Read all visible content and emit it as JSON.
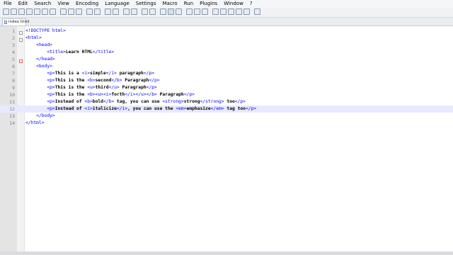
{
  "menu": [
    "File",
    "Edit",
    "Search",
    "View",
    "Encoding",
    "Language",
    "Settings",
    "Macro",
    "Run",
    "Plugins",
    "Window",
    "?"
  ],
  "tab": {
    "label": "index.html"
  },
  "lines": [
    {
      "n": "1",
      "segs": [
        [
          "t",
          "<!DOCTYPE html>"
        ]
      ]
    },
    {
      "n": "2",
      "segs": [
        [
          "t",
          "<html>"
        ]
      ]
    },
    {
      "n": "3",
      "segs": [
        [
          "",
          "    "
        ],
        [
          "t",
          "<head>"
        ]
      ]
    },
    {
      "n": "4",
      "segs": [
        [
          "",
          "        "
        ],
        [
          "t",
          "<title>"
        ],
        [
          "",
          "Learn HTML"
        ],
        [
          "t",
          "</title>"
        ]
      ]
    },
    {
      "n": "5",
      "segs": [
        [
          "",
          "    "
        ],
        [
          "t",
          "</head>"
        ]
      ]
    },
    {
      "n": "6",
      "segs": [
        [
          "",
          "    "
        ],
        [
          "t",
          "<body>"
        ]
      ]
    },
    {
      "n": "7",
      "segs": [
        [
          "",
          "        "
        ],
        [
          "t",
          "<p>"
        ],
        [
          "",
          "This is a "
        ],
        [
          "t",
          "<i>"
        ],
        [
          "",
          "simple"
        ],
        [
          "t",
          "</i>"
        ],
        [
          "",
          " paragraph"
        ],
        [
          "t",
          "</p>"
        ]
      ]
    },
    {
      "n": "8",
      "segs": [
        [
          "",
          "        "
        ],
        [
          "t",
          "<p>"
        ],
        [
          "",
          "This is the "
        ],
        [
          "t",
          "<b>"
        ],
        [
          "",
          "second"
        ],
        [
          "t",
          "</b>"
        ],
        [
          "",
          " Paragraph"
        ],
        [
          "t",
          "</p>"
        ]
      ]
    },
    {
      "n": "9",
      "segs": [
        [
          "",
          "        "
        ],
        [
          "t",
          "<p>"
        ],
        [
          "",
          "This is the "
        ],
        [
          "t",
          "<u>"
        ],
        [
          "",
          "third"
        ],
        [
          "t",
          "</u>"
        ],
        [
          "",
          " Paragraph"
        ],
        [
          "t",
          "</p>"
        ]
      ]
    },
    {
      "n": "10",
      "segs": [
        [
          "",
          "        "
        ],
        [
          "t",
          "<p>"
        ],
        [
          "",
          "This is the "
        ],
        [
          "t",
          "<b><u><i>"
        ],
        [
          "",
          "forth"
        ],
        [
          "t",
          "</i></u></b>"
        ],
        [
          "",
          " Paragraph"
        ],
        [
          "t",
          "</p>"
        ]
      ]
    },
    {
      "n": "11",
      "segs": [
        [
          "",
          "        "
        ],
        [
          "t",
          "<p>"
        ],
        [
          "",
          "Instead of "
        ],
        [
          "t",
          "<b>"
        ],
        [
          "",
          "bold"
        ],
        [
          "t",
          "</b>"
        ],
        [
          "",
          " tag, you can use "
        ],
        [
          "t",
          "<strong>"
        ],
        [
          "",
          "strong"
        ],
        [
          "t",
          "</strong>"
        ],
        [
          "",
          " too"
        ],
        [
          "t",
          "</p>"
        ]
      ]
    },
    {
      "n": "12",
      "segs": [
        [
          "",
          "        "
        ],
        [
          "t",
          "<p>"
        ],
        [
          "",
          "Instead of "
        ],
        [
          "t",
          "<i>"
        ],
        [
          "",
          "italicize"
        ],
        [
          "t",
          "</i>"
        ],
        [
          "",
          ", you can use the "
        ],
        [
          "t",
          "<em>"
        ],
        [
          "",
          "emphasize"
        ],
        [
          "t",
          "</em>"
        ],
        [
          "",
          " tag too"
        ],
        [
          "t",
          "</p>"
        ]
      ]
    },
    {
      "n": "13",
      "segs": [
        [
          "",
          "    "
        ],
        [
          "t",
          "</body>"
        ]
      ]
    },
    {
      "n": "14",
      "segs": [
        [
          "t",
          "</html>"
        ]
      ]
    }
  ],
  "colors": {
    "tag": "#0000ff",
    "text": "#000000",
    "current_line": "#e8e8ff",
    "gutter": "#e4e4e4"
  }
}
